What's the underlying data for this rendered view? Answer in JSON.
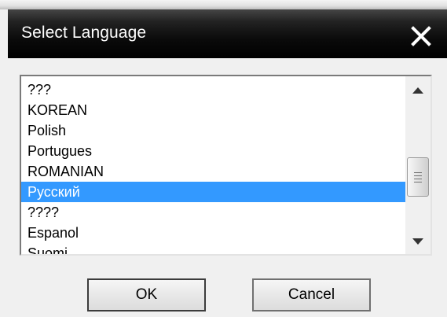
{
  "dialog": {
    "title": "Select Language"
  },
  "languages": {
    "items": [
      {
        "label": "???"
      },
      {
        "label": "KOREAN"
      },
      {
        "label": "Polish"
      },
      {
        "label": "Portugues"
      },
      {
        "label": "ROMANIAN"
      },
      {
        "label": "Русский"
      },
      {
        "label": "????"
      },
      {
        "label": "Espanol"
      },
      {
        "label": "Suomi"
      }
    ],
    "selected": "Русский"
  },
  "buttons": {
    "ok_label": "OK",
    "cancel_label": "Cancel"
  },
  "colors": {
    "selection": "#3399ff",
    "titlebar": "#000000"
  },
  "icons": {
    "close": "close-icon",
    "scroll_up": "arrow-up-icon",
    "scroll_down": "arrow-down-icon",
    "scroll_thumb_grip": "grip-icon"
  }
}
